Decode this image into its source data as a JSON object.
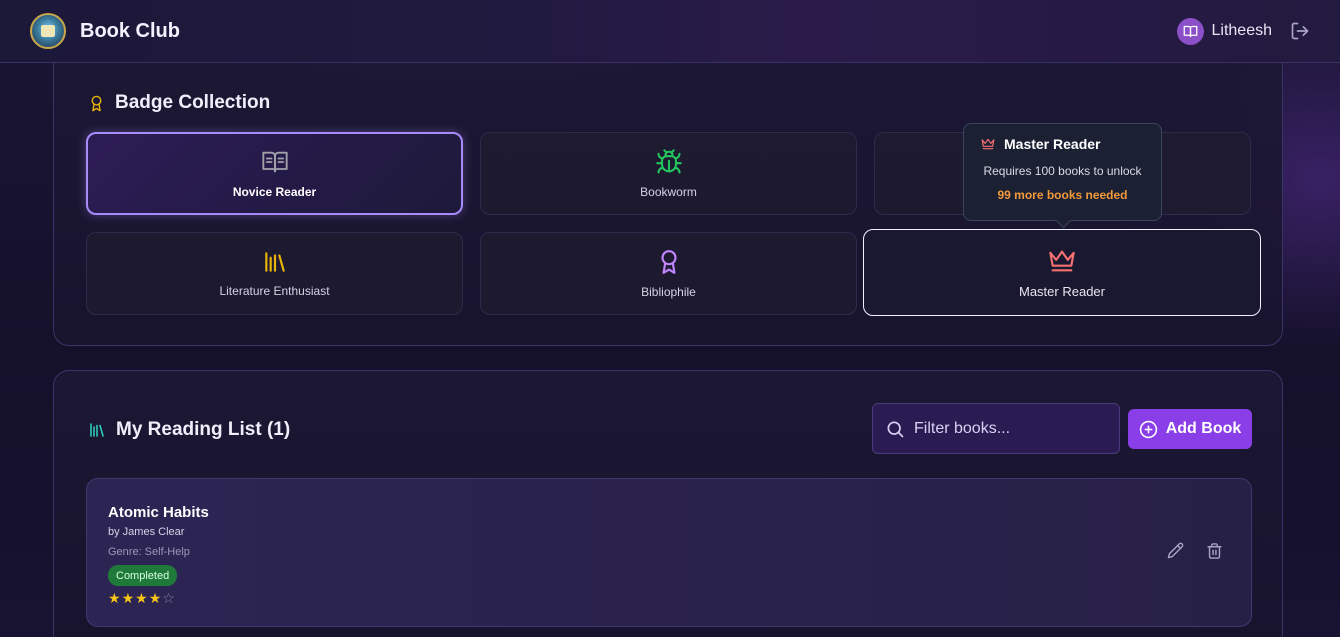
{
  "header": {
    "app_title": "Book Club",
    "user_name": "Litheesh",
    "icons": {
      "logo": "club-logo",
      "avatar": "book-open-icon",
      "logout": "logout-icon"
    }
  },
  "badges": {
    "title": "Badge Collection",
    "items": [
      {
        "label": "Novice Reader",
        "icon": "book-open-icon",
        "state": "unlocked",
        "color": "#a1a1aa"
      },
      {
        "label": "Bookworm",
        "icon": "bug-icon",
        "state": "locked",
        "color": "#22c55e"
      },
      {
        "label": "",
        "icon": "",
        "state": "locked-hidden-by-tooltip"
      },
      {
        "label": "Literature Enthusiast",
        "icon": "library-icon",
        "state": "locked",
        "color": "#eab308"
      },
      {
        "label": "Bibliophile",
        "icon": "award-icon",
        "state": "locked",
        "color": "#c084fc"
      },
      {
        "label": "Master Reader",
        "icon": "crown-icon",
        "state": "hovered",
        "color": "#f87171"
      }
    ],
    "tooltip": {
      "title": "Master Reader",
      "requirement": "Requires 100 books to unlock",
      "remaining": "99 more books needed"
    }
  },
  "reading_list": {
    "title": "My Reading List (1)",
    "filter_placeholder": "Filter books...",
    "add_button": "Add Book",
    "books": [
      {
        "title": "Atomic Habits",
        "author": "by James Clear",
        "genre": "Genre: Self-Help",
        "status": "Completed",
        "rating": 4,
        "max_rating": 5
      }
    ]
  },
  "colors": {
    "accent": "#8a3ee8",
    "badge_unlocked_border": "#a78bfa",
    "status_completed": "#1f7a3a",
    "tooltip_remaining": "#f29a3a",
    "star": "#f5c518"
  }
}
